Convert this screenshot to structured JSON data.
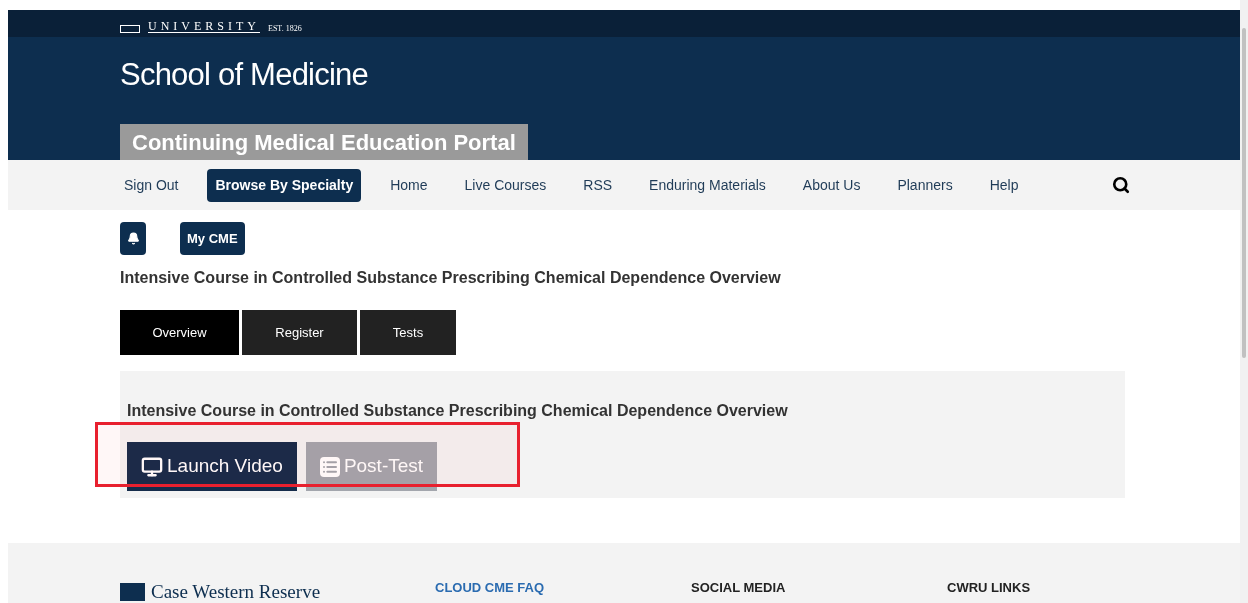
{
  "header": {
    "university": "UNIVERSITY",
    "established": "EST. 1826",
    "school": "School of Medicine",
    "portal": "Continuing Medical Education Portal"
  },
  "nav": [
    {
      "label": "Sign Out",
      "selected": false
    },
    {
      "label": "Browse By Specialty",
      "selected": true
    },
    {
      "label": "Home",
      "selected": false
    },
    {
      "label": "Live Courses",
      "selected": false
    },
    {
      "label": "RSS",
      "selected": false
    },
    {
      "label": "Enduring Materials",
      "selected": false
    },
    {
      "label": "About Us",
      "selected": false
    },
    {
      "label": "Planners",
      "selected": false
    },
    {
      "label": "Help",
      "selected": false
    }
  ],
  "my_cme": "My CME",
  "course_title": "Intensive Course in Controlled Substance Prescribing Chemical Dependence Overview",
  "tabs": [
    {
      "label": "Overview",
      "selected": true
    },
    {
      "label": "Register",
      "selected": false
    },
    {
      "label": "Tests",
      "selected": false
    }
  ],
  "panel": {
    "title": "Intensive Course in Controlled Substance Prescribing Chemical Dependence Overview",
    "buttons": [
      {
        "kind": "video",
        "label": "Launch Video",
        "disabled": false
      },
      {
        "kind": "test",
        "label": "Post-Test",
        "disabled": true
      }
    ]
  },
  "footer": {
    "logo": "Case Western Reserve",
    "columns": [
      {
        "heading": "CLOUD CME FAQ",
        "link": true
      },
      {
        "heading": "SOCIAL MEDIA",
        "link": false
      },
      {
        "heading": "CWRU LINKS",
        "link": false
      }
    ]
  }
}
